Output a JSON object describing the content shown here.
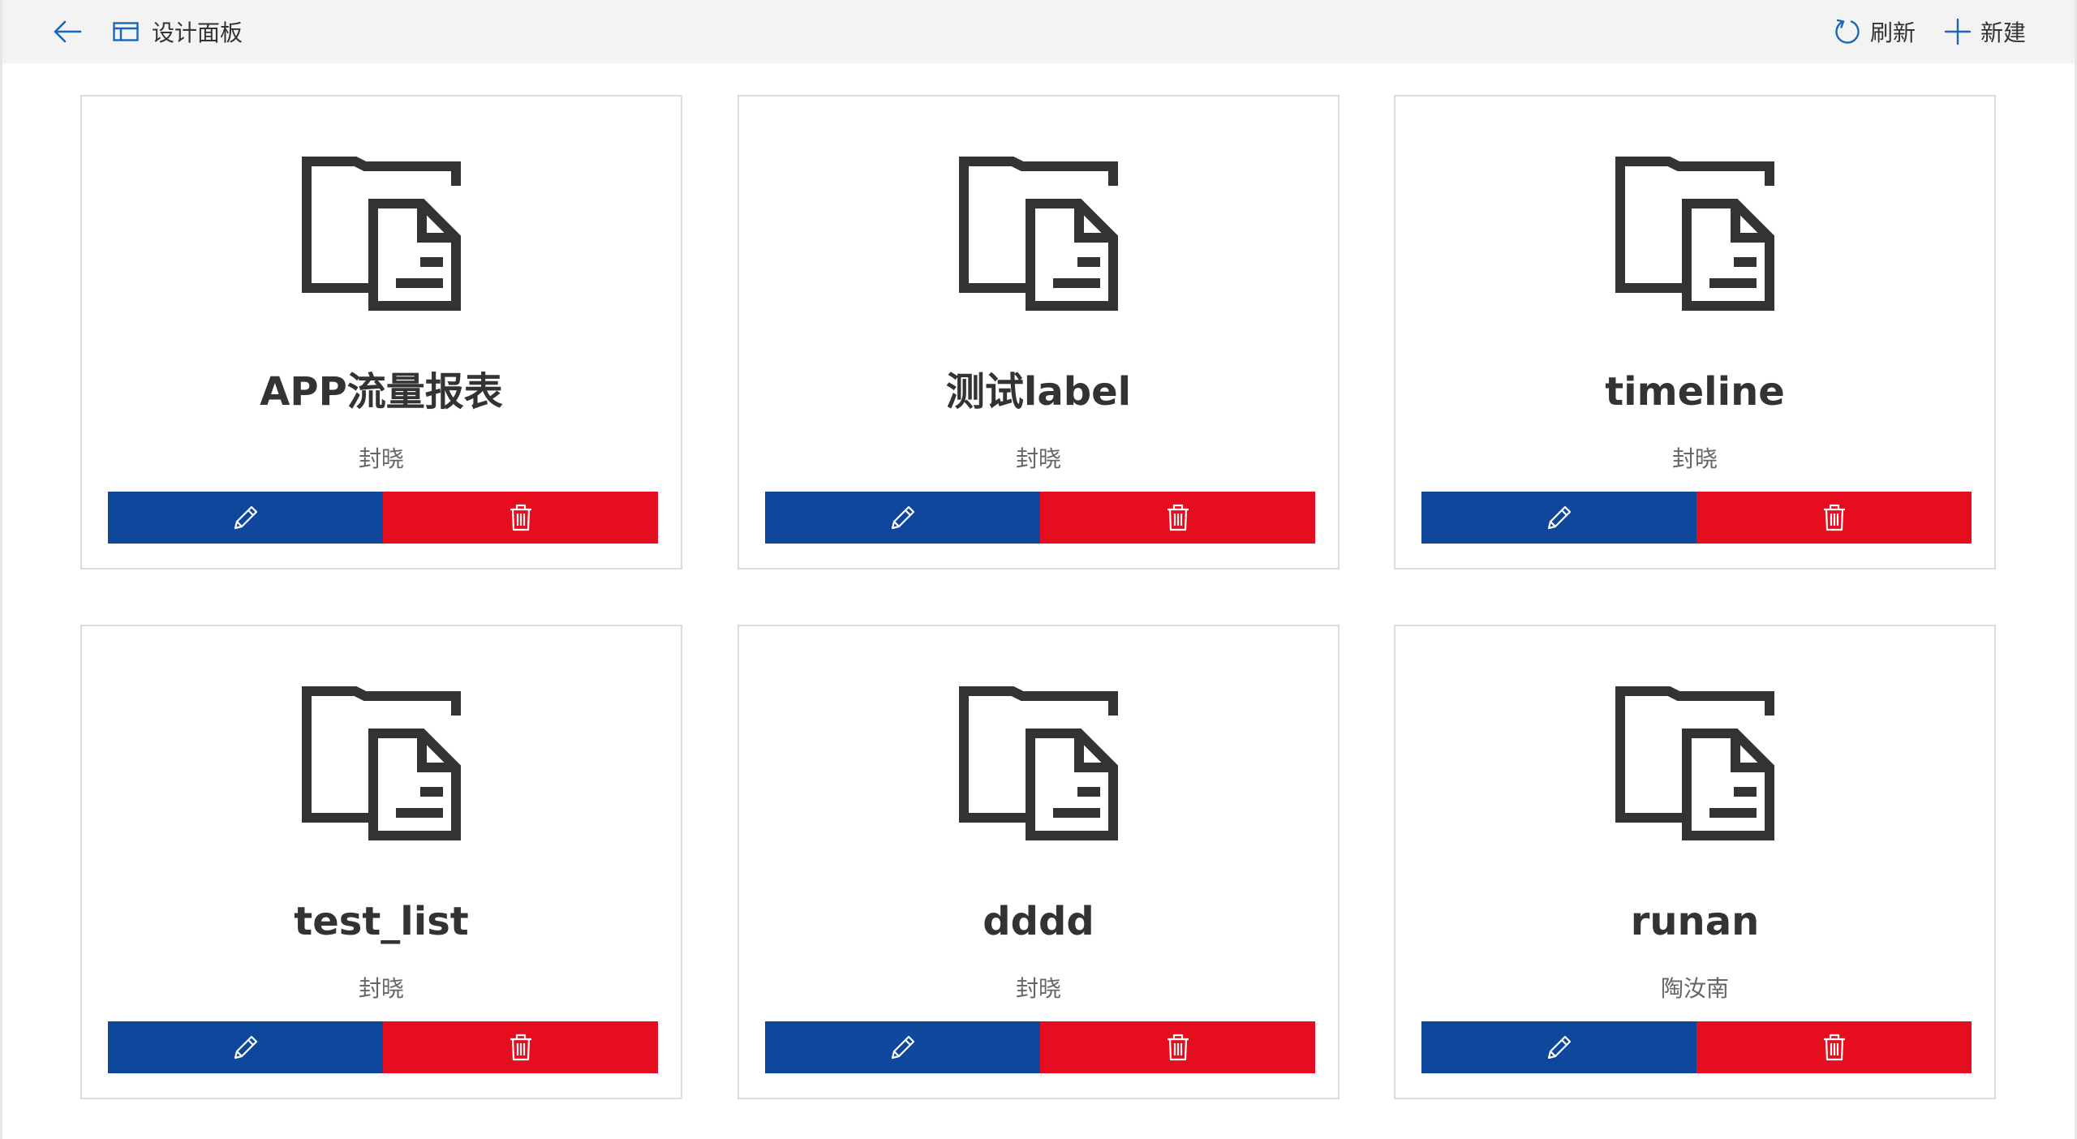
{
  "header": {
    "back_icon": "arrow-left-icon",
    "title_icon": "panel-layout-icon",
    "title": "设计面板",
    "refresh_label": "刷新",
    "refresh_icon": "refresh-icon",
    "create_label": "新建",
    "create_icon": "plus-icon"
  },
  "colors": {
    "accent": "#1a66b8",
    "edit_button": "#0f479d",
    "delete_button": "#e60e1e",
    "topbar_bg": "#f3f3f3"
  },
  "cards": [
    {
      "name": "APP流量报表",
      "author": "封晓",
      "icon": "folder-document-icon"
    },
    {
      "name": "测试label",
      "author": "封晓",
      "icon": "folder-document-icon"
    },
    {
      "name": "timeline",
      "author": "封晓",
      "icon": "folder-document-icon"
    },
    {
      "name": "test_list",
      "author": "封晓",
      "icon": "folder-document-icon"
    },
    {
      "name": "dddd",
      "author": "封晓",
      "icon": "folder-document-icon"
    },
    {
      "name": "runan",
      "author": "陶汝南",
      "icon": "folder-document-icon"
    }
  ],
  "card_actions": {
    "edit_icon": "pencil-icon",
    "delete_icon": "trash-icon"
  }
}
